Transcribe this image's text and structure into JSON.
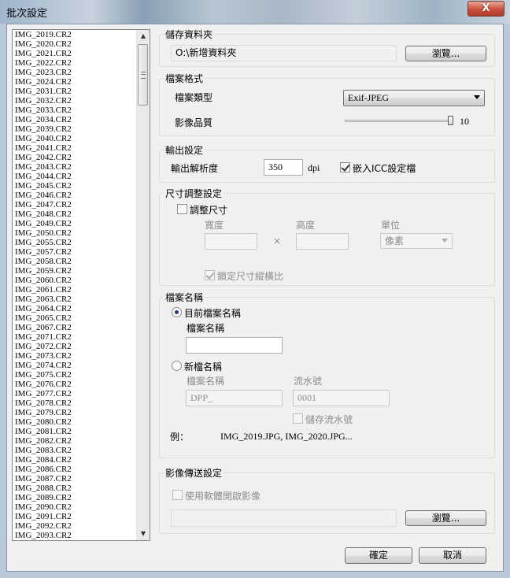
{
  "window": {
    "title": "批次設定",
    "close_glyph": "X"
  },
  "file_list": {
    "items": [
      "IMG_2019.CR2",
      "IMG_2020.CR2",
      "IMG_2021.CR2",
      "IMG_2022.CR2",
      "IMG_2023.CR2",
      "IMG_2024.CR2",
      "IMG_2031.CR2",
      "IMG_2032.CR2",
      "IMG_2033.CR2",
      "IMG_2034.CR2",
      "IMG_2039.CR2",
      "IMG_2040.CR2",
      "IMG_2041.CR2",
      "IMG_2042.CR2",
      "IMG_2043.CR2",
      "IMG_2044.CR2",
      "IMG_2045.CR2",
      "IMG_2046.CR2",
      "IMG_2047.CR2",
      "IMG_2048.CR2",
      "IMG_2049.CR2",
      "IMG_2050.CR2",
      "IMG_2055.CR2",
      "IMG_2057.CR2",
      "IMG_2058.CR2",
      "IMG_2059.CR2",
      "IMG_2060.CR2",
      "IMG_2061.CR2",
      "IMG_2063.CR2",
      "IMG_2064.CR2",
      "IMG_2065.CR2",
      "IMG_2067.CR2",
      "IMG_2071.CR2",
      "IMG_2072.CR2",
      "IMG_2073.CR2",
      "IMG_2074.CR2",
      "IMG_2075.CR2",
      "IMG_2076.CR2",
      "IMG_2077.CR2",
      "IMG_2078.CR2",
      "IMG_2079.CR2",
      "IMG_2080.CR2",
      "IMG_2081.CR2",
      "IMG_2082.CR2",
      "IMG_2083.CR2",
      "IMG_2084.CR2",
      "IMG_2086.CR2",
      "IMG_2087.CR2",
      "IMG_2088.CR2",
      "IMG_2089.CR2",
      "IMG_2090.CR2",
      "IMG_2091.CR2",
      "IMG_2092.CR2",
      "IMG_2093.CR2"
    ]
  },
  "save_folder": {
    "title": "儲存資料夾",
    "path": "O:\\新增資料夾",
    "browse_label": "瀏覽..."
  },
  "file_format": {
    "title": "檔案格式",
    "type_label": "檔案類型",
    "type_value": "Exif-JPEG",
    "quality_label": "影像品質",
    "quality_value": "10",
    "quality_fraction": 1.0
  },
  "output": {
    "title": "輸出設定",
    "resolution_label": "輸出解析度",
    "resolution_value": "350",
    "resolution_unit": "dpi",
    "embed_icc_label": "嵌入ICC設定檔",
    "embed_icc_checked": true
  },
  "resize": {
    "title": "尺寸調整設定",
    "resize_label": "調整尺寸",
    "width_label": "寬度",
    "height_label": "高度",
    "unit_label": "單位",
    "times": "×",
    "unit_value": "像素",
    "lock_ratio_label": "鎖定尺寸縱橫比"
  },
  "filename": {
    "title": "檔案名稱",
    "current_label": "目前檔案名稱",
    "current_field_label": "檔案名稱",
    "new_label": "新檔名稱",
    "new_field_label": "檔案名稱",
    "new_field_value": "DPP_",
    "serial_label": "流水號",
    "serial_value": "0001",
    "save_serial_label": "儲存流水號",
    "example_label": "例：",
    "example_value": "IMG_2019.JPG, IMG_2020.JPG..."
  },
  "transfer": {
    "title": "影像傳送設定",
    "open_with_label": "使用軟體開啟影像",
    "browse_label": "瀏覽..."
  },
  "footer": {
    "ok_label": "確定",
    "cancel_label": "取消"
  }
}
